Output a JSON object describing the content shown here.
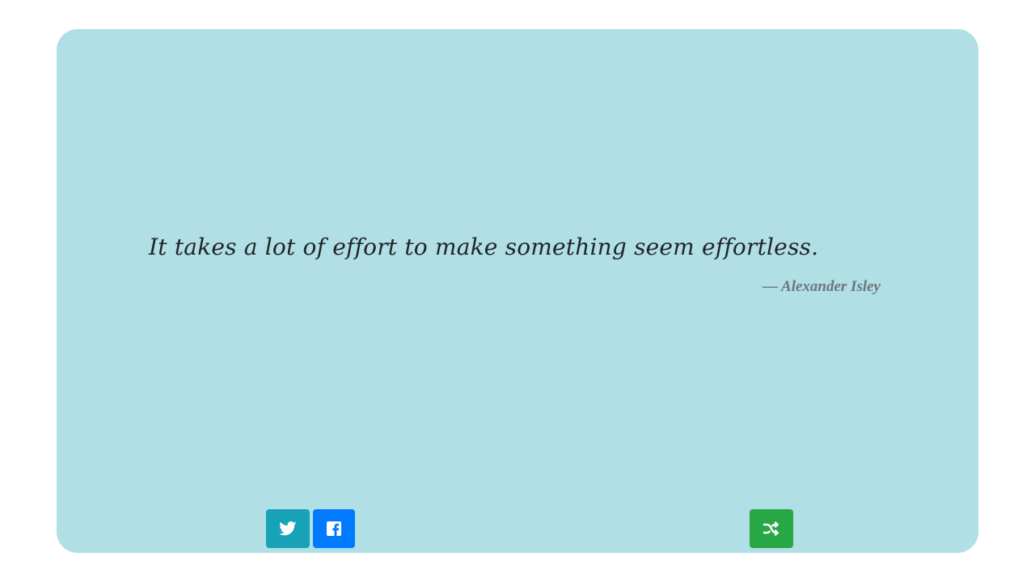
{
  "quote": {
    "text": "It takes a lot of effort to make something seem effortless.",
    "author": "— Alexander Isley"
  },
  "buttons": {
    "twitter": {
      "icon": "twitter-icon",
      "color": "#17a2b8"
    },
    "facebook": {
      "icon": "facebook-icon",
      "color": "#007bff"
    },
    "shuffle": {
      "icon": "shuffle-icon",
      "color": "#28a745"
    }
  },
  "colors": {
    "page_background": "#ffffff",
    "card_background": "#b0dfe5",
    "quote_text": "#212529",
    "author_text": "#6c757d"
  }
}
